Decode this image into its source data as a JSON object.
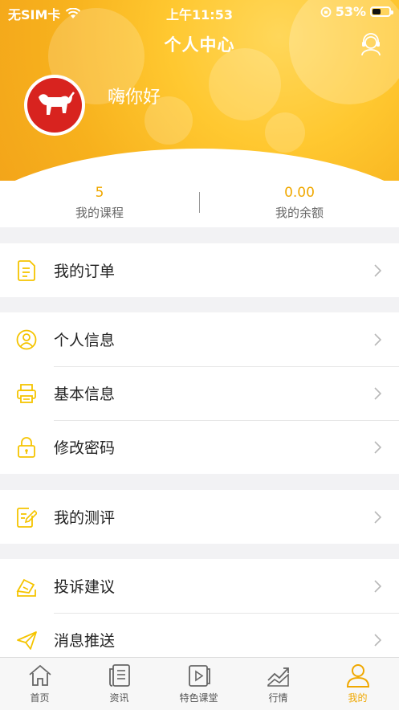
{
  "status_bar": {
    "carrier": "无SIM卡",
    "time": "上午11:53",
    "battery_percent": "53%",
    "battery_level": 0.53
  },
  "header": {
    "title": "个人中心",
    "greeting": "嗨你好",
    "service_icon": "customer-service-icon",
    "avatar_icon": "bull-logo-icon",
    "gradient_colors": [
      "#ffd75a",
      "#f7b11d",
      "#f3a51a"
    ]
  },
  "stats": {
    "courses": {
      "value": "5",
      "label": "我的课程"
    },
    "balance": {
      "value": "0.00",
      "label": "我的余额"
    }
  },
  "menu": {
    "orders": {
      "label": "我的订单",
      "icon": "document-icon"
    },
    "personal_info": {
      "label": "个人信息",
      "icon": "user-circle-icon"
    },
    "basic_info": {
      "label": "基本信息",
      "icon": "printer-icon"
    },
    "change_password": {
      "label": "修改密码",
      "icon": "lock-icon"
    },
    "evaluation": {
      "label": "我的测评",
      "icon": "edit-document-icon"
    },
    "complaints": {
      "label": "投诉建议",
      "icon": "feedback-icon"
    },
    "messages": {
      "label": "消息推送",
      "icon": "paper-plane-icon"
    }
  },
  "tabbar": {
    "home": "首页",
    "news": "资讯",
    "courses": "特色课堂",
    "market": "行情",
    "mine": "我的"
  },
  "colors": {
    "accent": "#f0a800",
    "bull_red": "#d8231f"
  }
}
